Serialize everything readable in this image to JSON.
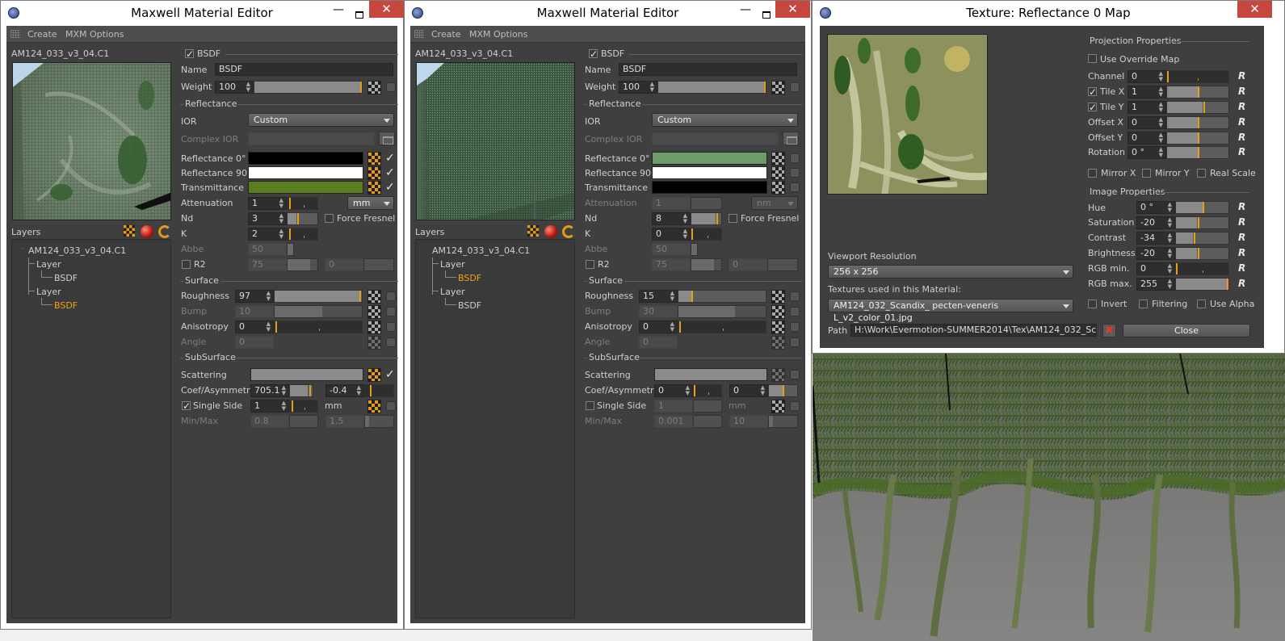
{
  "editor_left": {
    "title": "Maxwell Material Editor",
    "menus": [
      "Create",
      "MXM Options"
    ],
    "material_name": "AM124_033_v3_04.C1",
    "layers_label": "Layers",
    "tree": [
      {
        "label": "AM124_033_v3_04.C1"
      },
      {
        "label": "Layer"
      },
      {
        "label": "BSDF"
      },
      {
        "label": "Layer"
      },
      {
        "label": "BSDF"
      }
    ],
    "bsdf_header": "BSDF",
    "name_label": "Name",
    "name_value": "BSDF",
    "weight_label": "Weight",
    "weight_value": "100",
    "weight_fill": 1.0,
    "sec_reflectance": "Reflectance",
    "ior_label": "IOR",
    "ior_value": "Custom",
    "complex_ior_label": "Complex IOR",
    "refl0_label": "Reflectance 0°",
    "refl0_color": "#000000",
    "refl90_label": "Reflectance 90°",
    "refl90_color": "#ffffff",
    "trans_label": "Transmittance",
    "trans_color": "#5a7d1e",
    "atten_label": "Attenuation",
    "atten_value": "1",
    "atten_unit": "mm",
    "nd_label": "Nd",
    "nd_value": "3",
    "force_fresnel_label": "Force Fresnel",
    "k_label": "K",
    "k_value": "2",
    "abbe_label": "Abbe",
    "abbe_value": "50",
    "r2_label": "R2",
    "r2_value": "75",
    "r2_value2": "0",
    "sec_surface": "Surface",
    "rough_label": "Roughness",
    "rough_value": "97",
    "rough_fill": 0.97,
    "bump_label": "Bump",
    "bump_value": "10",
    "aniso_label": "Anisotropy",
    "aniso_value": "0",
    "angle_label": "Angle",
    "angle_value": "0",
    "sec_subsurface": "SubSurface",
    "scatter_label": "Scattering",
    "coef_label": "Coef/Asymmetry",
    "coef_value": "705.1",
    "asym_value": "-0.4",
    "single_side_label": "Single Side",
    "single_side_value": "1",
    "single_side_unit": "mm",
    "minmax_label": "Min/Max",
    "min_value": "0.8",
    "max_value": "1.5"
  },
  "editor_mid": {
    "title": "Maxwell Material Editor",
    "menus": [
      "Create",
      "MXM Options"
    ],
    "material_name": "AM124_033_v3_04.C1",
    "layers_label": "Layers",
    "tree": [
      {
        "label": "AM124_033_v3_04.C1"
      },
      {
        "label": "Layer"
      },
      {
        "label": "BSDF"
      },
      {
        "label": "Layer"
      },
      {
        "label": "BSDF"
      }
    ],
    "bsdf_header": "BSDF",
    "name_label": "Name",
    "name_value": "BSDF",
    "weight_label": "Weight",
    "weight_value": "100",
    "weight_fill": 1.0,
    "sec_reflectance": "Reflectance",
    "ior_label": "IOR",
    "ior_value": "Custom",
    "complex_ior_label": "Complex IOR",
    "refl0_label": "Reflectance 0°",
    "refl0_color": "#6e9b6a",
    "refl90_label": "Reflectance 90°",
    "refl90_color": "#ffffff",
    "trans_label": "Transmittance",
    "trans_color": "#000000",
    "atten_label": "Attenuation",
    "atten_value": "1",
    "atten_unit": "nm",
    "nd_label": "Nd",
    "nd_value": "8",
    "force_fresnel_label": "Force Fresnel",
    "k_label": "K",
    "k_value": "0",
    "abbe_label": "Abbe",
    "abbe_value": "50",
    "r2_label": "R2",
    "r2_value": "75",
    "r2_value2": "0",
    "sec_surface": "Surface",
    "rough_label": "Roughness",
    "rough_value": "15",
    "rough_fill": 0.15,
    "bump_label": "Bump",
    "bump_value": "30",
    "aniso_label": "Anisotropy",
    "aniso_value": "0",
    "angle_label": "Angle",
    "angle_value": "0",
    "sec_subsurface": "SubSurface",
    "scatter_label": "Scattering",
    "coef_label": "Coef/Asymmetry",
    "coef_value": "0",
    "asym_value": "0",
    "single_side_label": "Single Side",
    "single_side_value": "1",
    "single_side_unit": "mm",
    "minmax_label": "Min/Max",
    "min_value": "0.001",
    "max_value": "10"
  },
  "texture": {
    "title": "Texture: Reflectance 0 Map",
    "projection_header": "Projection Properties",
    "use_override_label": "Use Override Map",
    "channel_label": "Channel",
    "channel_value": "0",
    "tilex_label": "Tile X",
    "tilex_value": "1",
    "tiley_label": "Tile Y",
    "tiley_value": "1",
    "offx_label": "Offset X",
    "offx_value": "0",
    "offy_label": "Offset Y",
    "offy_value": "0",
    "rot_label": "Rotation",
    "rot_value": "0 °",
    "mirrorx_label": "Mirror X",
    "mirrory_label": "Mirror Y",
    "realscale_label": "Real Scale",
    "image_header": "Image Properties",
    "hue_label": "Hue",
    "hue_value": "0 °",
    "sat_label": "Saturation",
    "sat_value": "-20",
    "con_label": "Contrast",
    "con_value": "-34",
    "bri_label": "Brightness",
    "bri_value": "-20",
    "rgbmin_label": "RGB min.",
    "rgbmin_value": "0",
    "rgbmax_label": "RGB max.",
    "rgbmax_value": "255",
    "viewport_label": "Viewport Resolution",
    "viewport_value": "256 x 256",
    "textures_label": "Textures used in this Material:",
    "textures_value": "AM124_032_Scandix_ pecten-veneris L_v2_color_01.jpg",
    "invert_label": "Invert",
    "filtering_label": "Filtering",
    "usealpha_label": "Use Alpha",
    "path_label": "Path",
    "path_value": "H:\\Work\\Evermotion-SUMMER2014\\Tex\\AM124_032_Scandix",
    "close_label": "Close",
    "reset_glyph": "R"
  }
}
